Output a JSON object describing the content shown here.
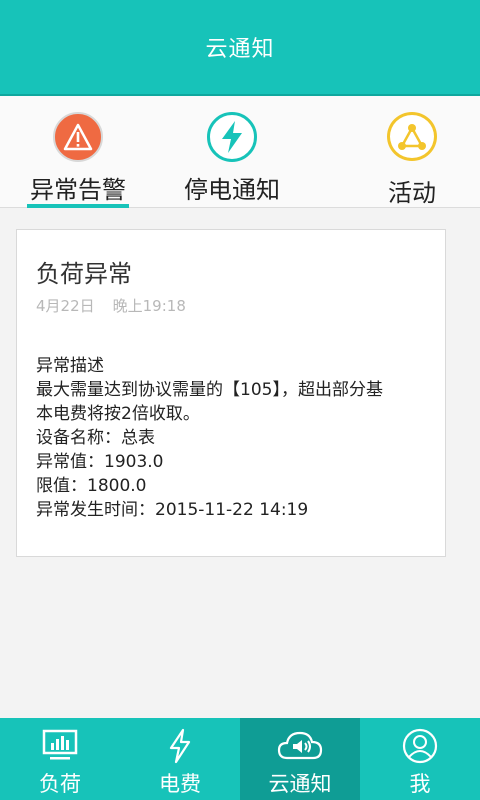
{
  "header": {
    "title": "云通知"
  },
  "tabs": [
    {
      "label": "异常告警",
      "icon": "warning-icon",
      "color": "#ef6a42",
      "active": true
    },
    {
      "label": "停电通知",
      "icon": "lightning-icon",
      "color": "#17c3b9",
      "active": false
    },
    {
      "label": "活动",
      "icon": "network-icon",
      "color": "#f3c52c",
      "active": false
    }
  ],
  "notice": {
    "title": "负荷异常",
    "date": "4月22日",
    "time": "晚上19:18",
    "lines": [
      "异常描述",
      "最大需量达到协议需量的【105】，超出部分基",
      "本电费将按2倍收取。",
      "设备名称：总表",
      "异常值：1903.0",
      "限值：1800.0",
      "异常发生时间：2015-11-22  14:19"
    ]
  },
  "bottom_nav": [
    {
      "label": "负荷",
      "icon": "monitor-chart-icon"
    },
    {
      "label": "电费",
      "icon": "lightning-outline-icon"
    },
    {
      "label": "云通知",
      "icon": "cloud-speaker-icon",
      "active": true
    },
    {
      "label": "我",
      "icon": "user-icon"
    }
  ],
  "colors": {
    "primary": "#17c3b9",
    "primary_dark": "#0f9d95",
    "alert": "#ef6a42",
    "gold": "#f3c52c"
  }
}
